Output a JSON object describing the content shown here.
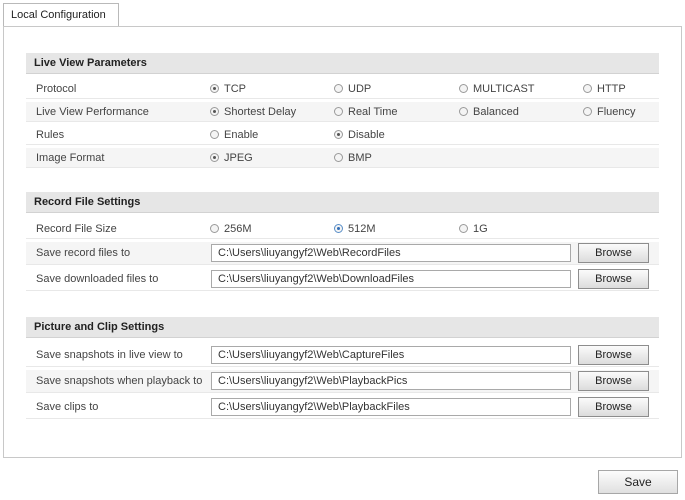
{
  "tab": {
    "label": "Local Configuration"
  },
  "live_view": {
    "heading": "Live View Parameters",
    "rows": [
      {
        "label": "Protocol",
        "options": [
          "TCP",
          "UDP",
          "MULTICAST",
          "HTTP"
        ],
        "selected": "TCP"
      },
      {
        "label": "Live View Performance",
        "options": [
          "Shortest Delay",
          "Real Time",
          "Balanced",
          "Fluency"
        ],
        "selected": "Shortest Delay"
      },
      {
        "label": "Rules",
        "options": [
          "Enable",
          "Disable"
        ],
        "selected": "Disable"
      },
      {
        "label": "Image Format",
        "options": [
          "JPEG",
          "BMP"
        ],
        "selected": "JPEG"
      }
    ]
  },
  "record": {
    "heading": "Record File Settings",
    "size_label": "Record File Size",
    "size_options": [
      "256M",
      "512M",
      "1G"
    ],
    "size_selected": "512M",
    "paths": [
      {
        "label": "Save record files to",
        "value": "C:\\Users\\liuyangyf2\\Web\\RecordFiles"
      },
      {
        "label": "Save downloaded files to",
        "value": "C:\\Users\\liuyangyf2\\Web\\DownloadFiles"
      }
    ]
  },
  "clip": {
    "heading": "Picture and Clip Settings",
    "paths": [
      {
        "label": "Save snapshots in live view to",
        "value": "C:\\Users\\liuyangyf2\\Web\\CaptureFiles"
      },
      {
        "label": "Save snapshots when playback to",
        "value": "C:\\Users\\liuyangyf2\\Web\\PlaybackPics"
      },
      {
        "label": "Save clips to",
        "value": "C:\\Users\\liuyangyf2\\Web\\PlaybackFiles"
      }
    ]
  },
  "buttons": {
    "browse": "Browse",
    "save": "Save"
  },
  "colors": {
    "section_bg": "#e6e6e6",
    "selected_blue": "#2f6cb5"
  }
}
